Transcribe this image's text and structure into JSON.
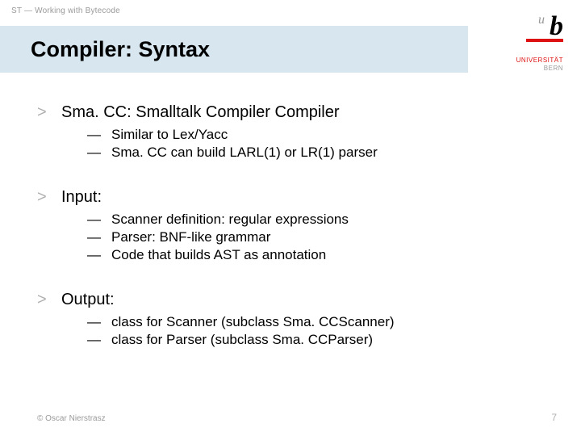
{
  "header": {
    "breadcrumb": "ST — Working with Bytecode"
  },
  "title": "Compiler: Syntax",
  "logo": {
    "u": "u",
    "b": "b",
    "line1": "UNIVERSITÄT",
    "line2": "BERN"
  },
  "blocks": [
    {
      "heading": "Sma. CC: Smalltalk Compiler Compiler",
      "items": [
        "Similar to Lex/Yacc",
        "Sma. CC can build LARL(1) or LR(1) parser"
      ]
    },
    {
      "heading": "Input:",
      "items": [
        "Scanner definition: regular expressions",
        "Parser: BNF-like grammar",
        "Code that builds AST as annotation"
      ]
    },
    {
      "heading": "Output:",
      "items": [
        "class for Scanner (subclass Sma. CCScanner)",
        "class for Parser (subclass Sma. CCParser)"
      ]
    }
  ],
  "footer": {
    "copyright": "© Oscar Nierstrasz",
    "page": "7"
  },
  "glyphs": {
    "gt": ">",
    "dash": "—"
  }
}
